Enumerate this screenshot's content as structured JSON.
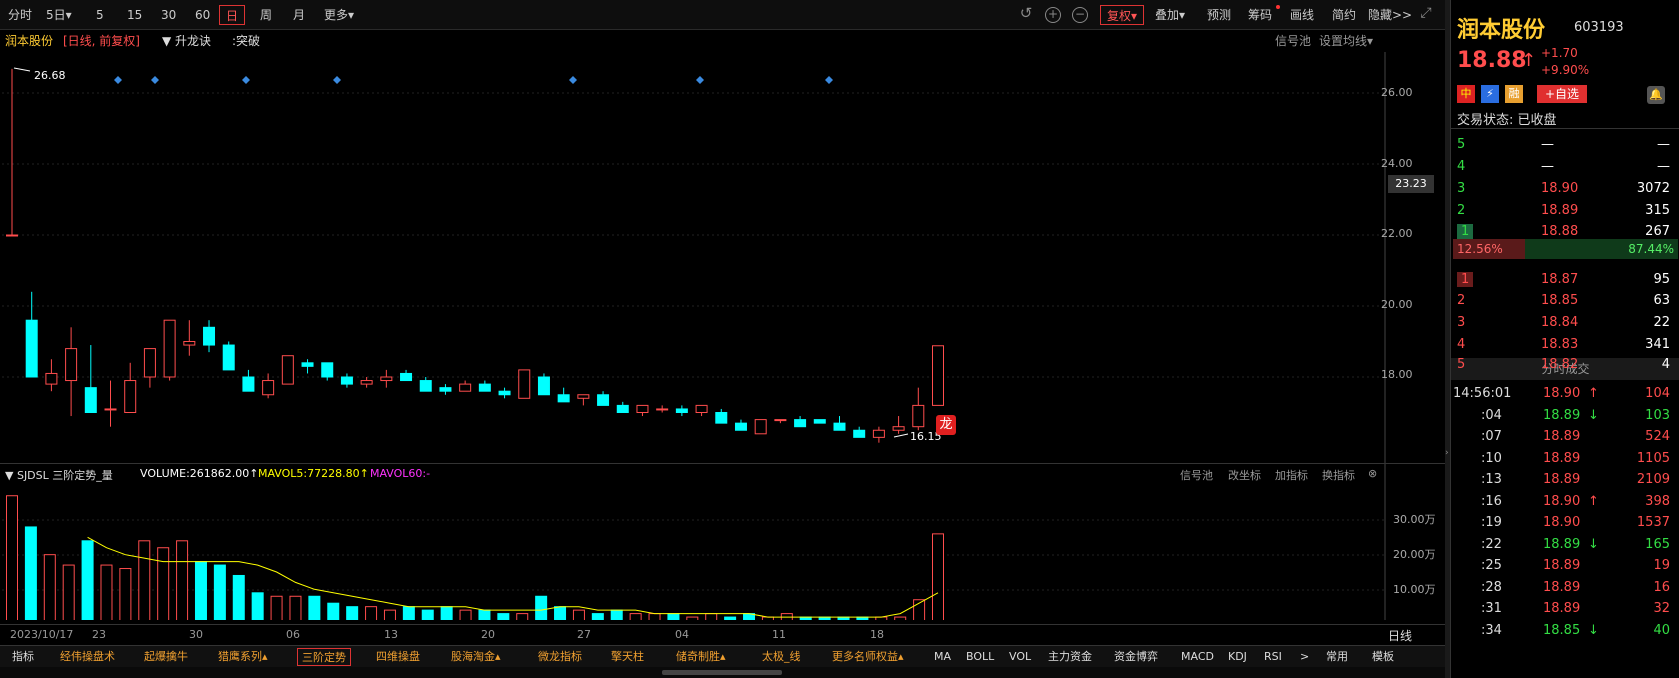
{
  "toolbar": {
    "items": [
      "分时",
      "5日▾",
      "5",
      "15",
      "30",
      "60",
      "日",
      "周",
      "月",
      "更多▾"
    ],
    "right_items": [
      "复权▾",
      "叠加▾",
      "预测",
      "筹码",
      "画线",
      "简约",
      "隐藏>>"
    ],
    "active": "日"
  },
  "subheader": {
    "name": "润本股份",
    "mode": "[日线, 前复权]",
    "indicator": "▼ 升龙诀",
    "breakout": ":突破",
    "right": [
      "信号池",
      "设置均线▾"
    ]
  },
  "price_axis": {
    "labels": [
      "26.00",
      "24.00",
      "22.00",
      "20.00",
      "18.00"
    ],
    "current": "23.23"
  },
  "annotations": {
    "high": "26.68",
    "low": "16.15",
    "dragon": "龙"
  },
  "date_axis": [
    "2023/10/17",
    "23",
    "30",
    "06",
    "13",
    "20",
    "27",
    "04",
    "11",
    "18"
  ],
  "vol_header": {
    "title": "▼ SJDSL 三阶定势_量",
    "volume": "VOLUME:261862.00↑",
    "mavol5": "MAVOL5:77228.80↑",
    "mavol60": "MAVOL60:-",
    "right": [
      "信号池",
      "改坐标",
      "加指标",
      "换指标",
      "⊗"
    ]
  },
  "vol_axis": [
    "30.00万",
    "20.00万",
    "10.00万"
  ],
  "period_label": "日线",
  "bottom_tabs": [
    "指标",
    "经伟操盘术",
    "起爆擒牛",
    "猎鹰系列▴",
    "三阶定势",
    "四维操盘",
    "股海淘金▴",
    "微龙指标",
    "擎天柱",
    "储奇制胜▴",
    "太极_线",
    "更多名师权益▴",
    "MA",
    "BOLL",
    "VOL",
    "主力资金",
    "资金博弈",
    "MACD",
    "KDJ",
    "RSI",
    ">",
    "常用",
    "模板"
  ],
  "stock": {
    "name": "润本股份",
    "code": "603193",
    "price": "18.88",
    "arrow": "↑",
    "change": "+1.70",
    "pct": "+9.90%",
    "badges": [
      "中",
      "⚡",
      "融",
      "+自选"
    ],
    "status": "交易状态: 已收盘"
  },
  "asks": [
    {
      "level": "5",
      "price": "—",
      "vol": "—"
    },
    {
      "level": "4",
      "price": "—",
      "vol": "—"
    },
    {
      "level": "3",
      "price": "18.90",
      "vol": "3072"
    },
    {
      "level": "2",
      "price": "18.89",
      "vol": "315"
    },
    {
      "level": "1",
      "price": "18.88",
      "vol": "267"
    }
  ],
  "ratio": {
    "left": "12.56%",
    "right": "87.44%"
  },
  "bids": [
    {
      "level": "1",
      "price": "18.87",
      "vol": "95"
    },
    {
      "level": "2",
      "price": "18.85",
      "vol": "63"
    },
    {
      "level": "3",
      "price": "18.84",
      "vol": "22"
    },
    {
      "level": "4",
      "price": "18.83",
      "vol": "341"
    },
    {
      "level": "5",
      "price": "18.82",
      "vol": "4"
    }
  ],
  "ticks_title": "分时成交",
  "ticks": [
    {
      "time": "14:56:01",
      "price": "18.90",
      "dir": "↑",
      "vol": "104",
      "c": "red"
    },
    {
      "time": ":04",
      "price": "18.89",
      "dir": "↓",
      "vol": "103",
      "c": "green"
    },
    {
      "time": ":07",
      "price": "18.89",
      "dir": "",
      "vol": "524",
      "c": "red"
    },
    {
      "time": ":10",
      "price": "18.89",
      "dir": "",
      "vol": "1105",
      "c": "red"
    },
    {
      "time": ":13",
      "price": "18.89",
      "dir": "",
      "vol": "2109",
      "c": "red"
    },
    {
      "time": ":16",
      "price": "18.90",
      "dir": "↑",
      "vol": "398",
      "c": "red"
    },
    {
      "time": ":19",
      "price": "18.90",
      "dir": "",
      "vol": "1537",
      "c": "red"
    },
    {
      "time": ":22",
      "price": "18.89",
      "dir": "↓",
      "vol": "165",
      "c": "green"
    },
    {
      "time": ":25",
      "price": "18.89",
      "dir": "",
      "vol": "19",
      "c": "red"
    },
    {
      "time": ":28",
      "price": "18.89",
      "dir": "",
      "vol": "16",
      "c": "red"
    },
    {
      "time": ":31",
      "price": "18.89",
      "dir": "",
      "vol": "32",
      "c": "red"
    },
    {
      "time": ":34",
      "price": "18.85",
      "dir": "↓",
      "vol": "40",
      "c": "green"
    }
  ],
  "chart_data": {
    "type": "candlestick",
    "ylim": [
      16,
      27
    ],
    "candles": [
      [
        22.0,
        26.68,
        22.0,
        22.0
      ],
      [
        19.6,
        20.4,
        18.0,
        18.0
      ],
      [
        17.8,
        18.5,
        17.6,
        18.1
      ],
      [
        17.9,
        19.4,
        16.9,
        18.8
      ],
      [
        17.7,
        18.9,
        17.0,
        17.0
      ],
      [
        17.1,
        17.9,
        16.6,
        17.1
      ],
      [
        17.0,
        18.4,
        17.0,
        17.9
      ],
      [
        18.0,
        18.6,
        17.7,
        18.8
      ],
      [
        18.0,
        19.6,
        17.9,
        19.6
      ],
      [
        18.9,
        19.6,
        18.6,
        19.0
      ],
      [
        19.4,
        19.6,
        18.7,
        18.9
      ],
      [
        18.9,
        19.0,
        18.2,
        18.2
      ],
      [
        18.0,
        18.2,
        17.6,
        17.6
      ],
      [
        17.5,
        18.1,
        17.4,
        17.9
      ],
      [
        17.8,
        18.4,
        17.8,
        18.6
      ],
      [
        18.4,
        18.5,
        18.1,
        18.3
      ],
      [
        18.4,
        18.4,
        17.9,
        18.0
      ],
      [
        18.0,
        18.1,
        17.7,
        17.8
      ],
      [
        17.8,
        18.0,
        17.7,
        17.9
      ],
      [
        17.9,
        18.2,
        17.7,
        18.0
      ],
      [
        18.1,
        18.2,
        17.9,
        17.9
      ],
      [
        17.9,
        18.0,
        17.7,
        17.6
      ],
      [
        17.7,
        17.8,
        17.5,
        17.6
      ],
      [
        17.6,
        17.9,
        17.6,
        17.8
      ],
      [
        17.8,
        17.9,
        17.7,
        17.6
      ],
      [
        17.6,
        17.7,
        17.4,
        17.5
      ],
      [
        17.4,
        18.2,
        17.4,
        18.2
      ],
      [
        18.0,
        18.1,
        17.5,
        17.5
      ],
      [
        17.5,
        17.7,
        17.3,
        17.3
      ],
      [
        17.4,
        17.5,
        17.2,
        17.5
      ],
      [
        17.5,
        17.6,
        17.2,
        17.2
      ],
      [
        17.2,
        17.3,
        17.0,
        17.0
      ],
      [
        17.0,
        17.2,
        16.9,
        17.2
      ],
      [
        17.1,
        17.2,
        17.0,
        17.1
      ],
      [
        17.1,
        17.2,
        16.9,
        17.0
      ],
      [
        17.0,
        17.2,
        16.9,
        17.2
      ],
      [
        17.0,
        17.1,
        16.8,
        16.7
      ],
      [
        16.7,
        16.8,
        16.5,
        16.5
      ],
      [
        16.4,
        16.8,
        16.4,
        16.8
      ],
      [
        16.8,
        16.8,
        16.7,
        16.8
      ],
      [
        16.8,
        16.9,
        16.6,
        16.6
      ],
      [
        16.8,
        16.8,
        16.7,
        16.7
      ],
      [
        16.7,
        16.9,
        16.5,
        16.5
      ],
      [
        16.5,
        16.6,
        16.3,
        16.3
      ],
      [
        16.3,
        16.6,
        16.15,
        16.5
      ],
      [
        16.5,
        16.9,
        16.4,
        16.6
      ],
      [
        16.6,
        17.7,
        16.5,
        17.2
      ],
      [
        17.2,
        18.88,
        17.2,
        18.88
      ]
    ],
    "volumes": [
      37,
      28,
      20,
      17,
      24,
      17,
      16,
      24,
      22,
      24,
      18,
      17,
      14,
      9,
      8,
      8,
      8,
      6,
      5,
      5,
      4,
      5,
      4,
      5,
      4,
      4,
      3,
      3,
      8,
      5,
      4,
      3,
      4,
      3,
      3,
      3,
      2,
      3,
      2,
      3,
      2,
      3,
      2,
      2,
      2,
      2,
      2,
      2,
      7,
      26
    ],
    "mavol5": [
      null,
      null,
      null,
      null,
      25,
      22,
      20,
      19,
      18,
      18,
      18,
      18,
      18,
      17,
      15,
      12,
      10,
      9,
      8,
      7,
      6,
      5,
      5,
      5,
      5,
      4,
      4,
      4,
      4,
      5,
      5,
      4,
      4,
      4,
      3,
      3,
      3,
      3,
      3,
      3,
      2,
      2,
      2,
      2,
      2,
      2,
      2,
      3,
      6,
      9
    ]
  }
}
